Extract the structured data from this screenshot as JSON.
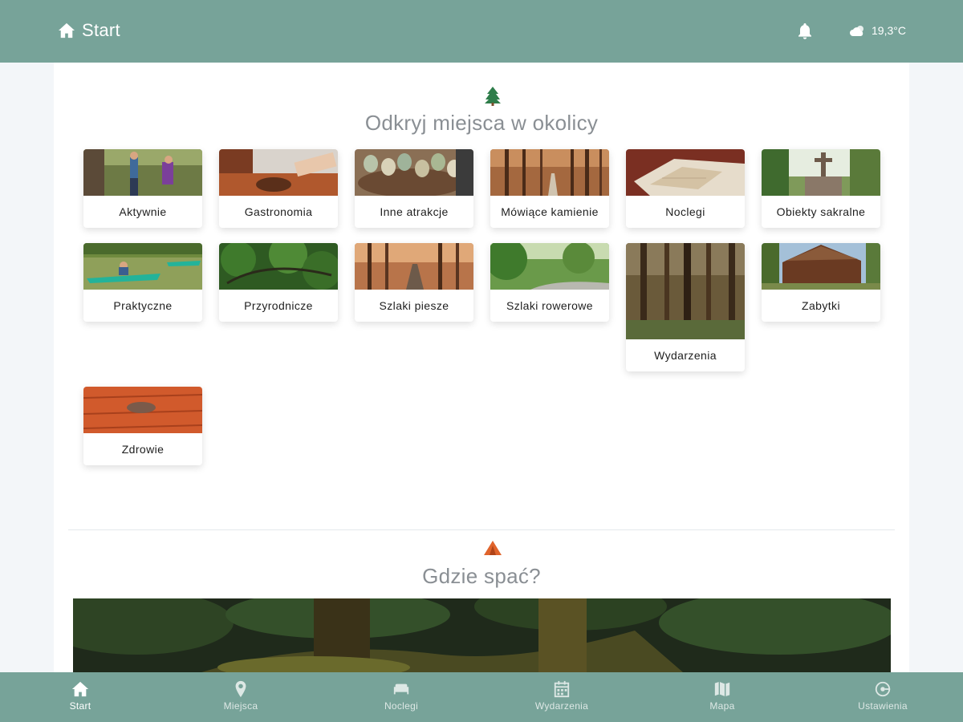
{
  "header": {
    "home_label": "Start",
    "weather_temp": "19,3°C",
    "icons": {
      "home": "home-icon",
      "bell": "bell-icon",
      "weather": "cloud-sun-icon"
    }
  },
  "discover": {
    "title": "Odkryj miejsca w okolicy",
    "icon": "pine-tree-icon",
    "categories": [
      {
        "label": "Aktywnie"
      },
      {
        "label": "Gastronomia"
      },
      {
        "label": "Inne atrakcje"
      },
      {
        "label": "Mówiące kamienie"
      },
      {
        "label": "Noclegi"
      },
      {
        "label": "Obiekty sakralne"
      },
      {
        "label": "Praktyczne"
      },
      {
        "label": "Przyrodnicze"
      },
      {
        "label": "Szlaki piesze"
      },
      {
        "label": "Szlaki rowerowe"
      },
      {
        "label": "Wydarzenia"
      },
      {
        "label": "Zabytki"
      },
      {
        "label": "Zdrowie"
      }
    ]
  },
  "sleep": {
    "title": "Gdzie spać?",
    "icon": "tent-icon"
  },
  "bottom_nav": [
    {
      "label": "Start",
      "icon": "home-icon"
    },
    {
      "label": "Miejsca",
      "icon": "map-pin-icon"
    },
    {
      "label": "Noclegi",
      "icon": "bed-icon"
    },
    {
      "label": "Wydarzenia",
      "icon": "calendar-icon"
    },
    {
      "label": "Mapa",
      "icon": "map-icon"
    },
    {
      "label": "Ustawienia",
      "icon": "settings-icon"
    }
  ],
  "colors": {
    "bar": "#77a399",
    "title_text": "#8a8f94"
  }
}
